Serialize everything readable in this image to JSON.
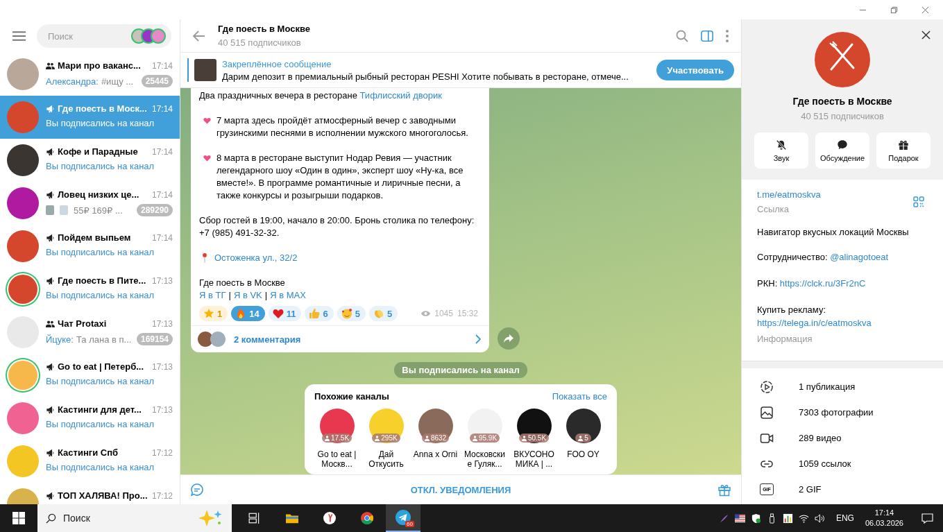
{
  "sidebar": {
    "search": {
      "placeholder": "Поиск"
    },
    "chats": [
      {
        "kind": "group",
        "title": "Мари про ваканс...",
        "time": "17:14",
        "sender": "Александра:",
        "preview": "#ищу ...",
        "service": false,
        "badge": "25445",
        "selected": false,
        "story_ring": false,
        "color": "#b9a89a"
      },
      {
        "kind": "channel",
        "title": "Где поесть в Моск...",
        "time": "17:14",
        "preview": "Вы подписались на канал",
        "service": true,
        "selected": true,
        "story_ring": false,
        "color": "#d4472c"
      },
      {
        "kind": "channel",
        "title": "Кофе и Парадные",
        "time": "17:14",
        "preview": "Вы подписались на канал",
        "service": true,
        "selected": false,
        "story_ring": false,
        "color": "#3a3530"
      },
      {
        "kind": "channel",
        "title": "Ловец низких це...",
        "time": "17:14",
        "media": true,
        "preview": "55₽ 169₽ ...",
        "service": false,
        "badge": "289290",
        "selected": false,
        "story_ring": false,
        "color": "#b01aa0"
      },
      {
        "kind": "channel",
        "title": "Пойдем выпьем",
        "time": "17:14",
        "preview": "Вы подписались на канал",
        "service": true,
        "selected": false,
        "story_ring": false,
        "color": "#d4472c"
      },
      {
        "kind": "channel",
        "title": "Где поесть в Пите...",
        "time": "17:13",
        "preview": "Вы подписались на канал",
        "service": true,
        "selected": false,
        "story_ring": true,
        "color": "#d4472c"
      },
      {
        "kind": "group",
        "title": "Чат Protaxi",
        "time": "17:13",
        "sender": "Йцуке:",
        "preview": "Та лана в п...",
        "service": false,
        "badge": "169154",
        "selected": false,
        "story_ring": false,
        "color": "#e9e9e9"
      },
      {
        "kind": "channel",
        "title": "Go to eat | Петерб...",
        "time": "17:13",
        "preview": "Вы подписались на канал",
        "service": true,
        "selected": false,
        "story_ring": true,
        "color": "#f7b84b"
      },
      {
        "kind": "channel",
        "title": "Кастинги для дет...",
        "time": "17:13",
        "preview": "Вы подписались на канал",
        "service": true,
        "selected": false,
        "story_ring": false,
        "color": "#f06292"
      },
      {
        "kind": "channel",
        "title": "Кастинги Спб",
        "time": "17:12",
        "preview": "Вы подписались на канал",
        "service": true,
        "selected": false,
        "story_ring": false,
        "color": "#f3c623"
      },
      {
        "kind": "channel",
        "title": "ТОП ХАЛЯВА! Про...",
        "time": "17:12",
        "selected": false,
        "story_ring": false,
        "color": "#d8b24a"
      }
    ]
  },
  "chat": {
    "title": "Где поесть в Москве",
    "subtitle": "40 515 подписчиков",
    "info_panel_open": true,
    "pinned": {
      "label": "Закреплённое сообщение",
      "text": "Дарим депозит в премиальный рыбный ресторан PESHI  Хотите побывать в ресторане, отмече...",
      "button": "Участвовать"
    },
    "message": {
      "paragraphs": [
        {
          "text": "Два праздничных вечера в ресторане",
          "link": "Тифлисский дворик"
        },
        {
          "kind": "heart",
          "text": "7 марта здесь пройдёт атмосферный вечер с заводными грузинскими песнями в исполнении мужского многоголосья."
        },
        {
          "kind": "heart",
          "text": "8 марта в ресторане выступит Нодар Ревия — участник легендарного шоу «Один в один», эксперт шоу «Ну-ка, все вместе!». В программе романтичные и лиричные песни, а также конкурсы и розыгрыши подарков."
        },
        {
          "text": "Сбор гостей в 19:00, начало в 20:00. Бронь столика по телефону: +7 (985) 491-32-32."
        },
        {
          "kind": "pin",
          "link": "Остоженка ул., 32/2"
        }
      ],
      "signature": "Где поесть в Москве",
      "links": [
        "Я в ТГ",
        "Я в VK",
        "Я в MAX"
      ],
      "separator": "|",
      "reactions": [
        {
          "kind": "star",
          "count": "1",
          "selected": false
        },
        {
          "kind": "fire",
          "count": "14",
          "selected": true
        },
        {
          "kind": "heart",
          "count": "11",
          "selected": false
        },
        {
          "kind": "thumbs",
          "count": "6",
          "selected": false
        },
        {
          "kind": "smile",
          "count": "5",
          "selected": false
        },
        {
          "kind": "clap",
          "count": "5",
          "selected": false
        }
      ],
      "views": "1045",
      "time": "15:32",
      "comments": "2 комментария"
    },
    "service_message": "Вы подписались на канал",
    "similar": {
      "title": "Похожие каналы",
      "show_all": "Показать все",
      "channels": [
        {
          "name": "Go to eat | Москв...",
          "count": "17.5K",
          "color": "#e8384f"
        },
        {
          "name": "Дай Откусить",
          "count": "295K",
          "color": "#f7d02c"
        },
        {
          "name": "Anna x Orni",
          "count": "8632",
          "color": "#8a6a5a"
        },
        {
          "name": "Московские Гуляк...",
          "count": "95.9K",
          "color": "#f2f2f2"
        },
        {
          "name": "ВКУСОНОМИКА | ...",
          "count": "50.5K",
          "color": "#111111"
        },
        {
          "name": "FOO OY",
          "count": "5",
          "color": "#2a2a2a"
        }
      ]
    },
    "bottom_button": "ОТКЛ. УВЕДОМЛЕНИЯ"
  },
  "profile": {
    "name": "Где поесть в Москве",
    "subtitle": "40 515 подписчиков",
    "actions": [
      {
        "kind": "mute",
        "label": "Звук"
      },
      {
        "kind": "discussion",
        "label": "Обсуждение"
      },
      {
        "kind": "gift",
        "label": "Подарок"
      }
    ],
    "link": "t.me/eatmoskva",
    "link_label": "Ссылка",
    "description": "Навигатор вкусных локаций Москвы",
    "contacts": [
      {
        "label": "Сотрудничество:",
        "link": "@alinagotoeat"
      },
      {
        "label": "РКН:",
        "link": "https://clck.ru/3Fr2nC"
      },
      {
        "label": "Купить рекламу:",
        "link": "https://telega.in/c/eatmoskva"
      }
    ],
    "info_label": "Информация",
    "media": [
      {
        "kind": "stories",
        "label": "1 публикация"
      },
      {
        "kind": "photo",
        "label": "7303 фотографии"
      },
      {
        "kind": "video",
        "label": "289 видео"
      },
      {
        "kind": "link",
        "label": "1059 ссылок"
      },
      {
        "kind": "gif",
        "icon_text": "GIF",
        "label": "2 GIF"
      }
    ]
  },
  "taskbar": {
    "search": "Поиск",
    "telegram_badge": "60",
    "language": "ENG",
    "time": "17:14",
    "date": "06.03.2026"
  }
}
